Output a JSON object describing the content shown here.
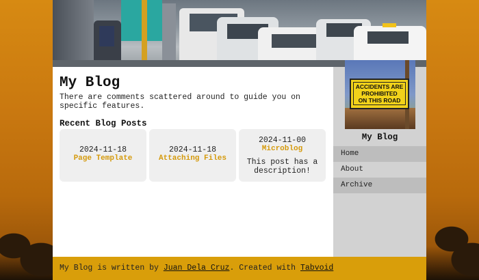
{
  "site": {
    "title": "My Blog",
    "intro": "There are comments scattered around to guide you on specific features."
  },
  "recent": {
    "heading": "Recent Blog Posts",
    "posts": [
      {
        "date": "2024-11-18",
        "title": "Page Template",
        "description": ""
      },
      {
        "date": "2024-11-18",
        "title": "Attaching Files",
        "description": ""
      },
      {
        "date": "2024-11-00",
        "title": "Microblog",
        "description": "This post has a description!"
      }
    ]
  },
  "sidebar": {
    "title": "My Blog",
    "sign_text": [
      "ACCIDENTS ARE",
      "PROHIBITED",
      "ON THIS ROAD"
    ],
    "nav": [
      {
        "label": "Home"
      },
      {
        "label": "About"
      },
      {
        "label": "Archive"
      }
    ]
  },
  "footer": {
    "prefix": "My Blog is written by ",
    "author": "Juan Dela Cruz",
    "middle": ". Created with ",
    "tool": "Tabvoid"
  },
  "colors": {
    "accent": "#d99e0a",
    "link_title": "#d59a0c",
    "sidebar_bg": "#d2d2d2",
    "nav_shade": "#bdbdbd",
    "card_bg": "#efefef"
  }
}
